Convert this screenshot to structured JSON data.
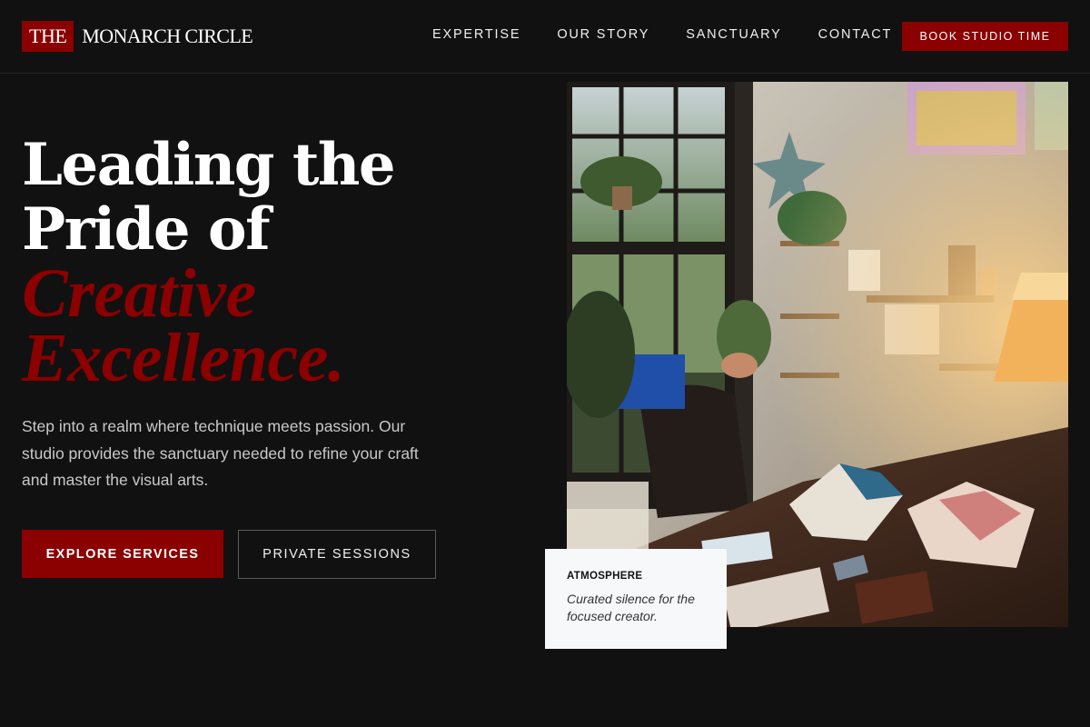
{
  "brand": {
    "mark": "THE",
    "name": "MONARCH CIRCLE",
    "accent_color": "#8b0000"
  },
  "nav": {
    "items": [
      "EXPERTISE",
      "OUR STORY",
      "SANCTUARY",
      "CONTACT"
    ],
    "cta_label": "BOOK STUDIO TIME"
  },
  "hero": {
    "headline_line1": "Leading the",
    "headline_line2": "Pride of",
    "headline_accent1": "Creative",
    "headline_accent2": "Excellence.",
    "intro": "Step into a realm where technique meets passion. Our studio provides the sanctuary needed to refine your craft and master the visual arts.",
    "primary_button": "EXPLORE SERVICES",
    "secondary_button": "PRIVATE SESSIONS"
  },
  "feature_card": {
    "title": "ATMOSPHERE",
    "text": "Curated silence for the focused creator."
  }
}
